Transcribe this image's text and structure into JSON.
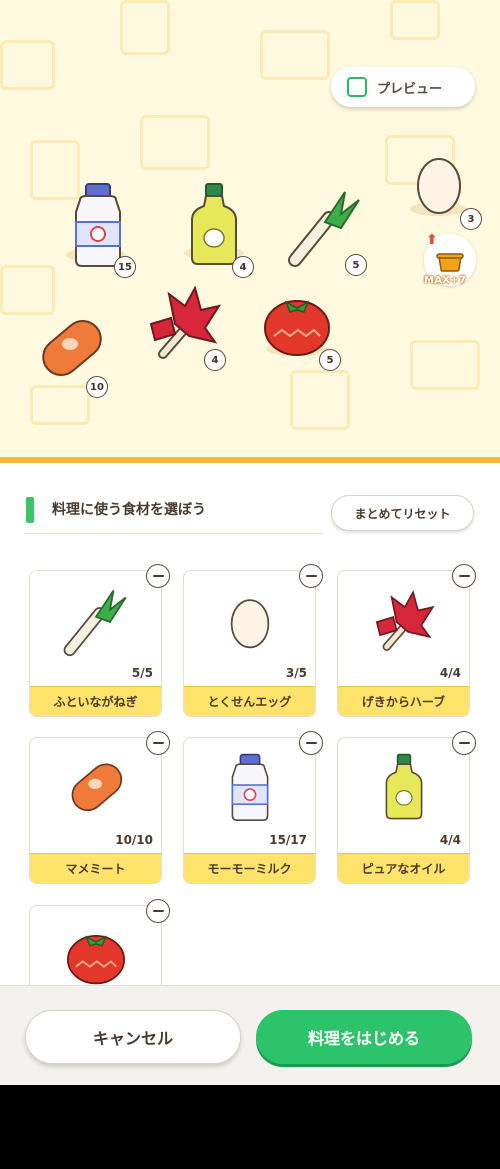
{
  "preview": {
    "label": "プレビュー",
    "checked": false
  },
  "stage_items": [
    {
      "name": "milk",
      "count": "15"
    },
    {
      "name": "oil",
      "count": "4"
    },
    {
      "name": "leek",
      "count": "5"
    },
    {
      "name": "egg",
      "count": "3"
    },
    {
      "name": "sausage",
      "count": "10"
    },
    {
      "name": "herb",
      "count": "4"
    },
    {
      "name": "tomato",
      "count": "5"
    }
  ],
  "pot": {
    "max_label": "MAX+7",
    "icon": "cooking-pot-icon"
  },
  "section": {
    "title": "料理に使う食材を選ぼう",
    "reset_label": "まとめてリセット"
  },
  "cards": [
    {
      "name": "ふといながねぎ",
      "qty": "5/5",
      "icon": "leek"
    },
    {
      "name": "とくせんエッグ",
      "qty": "3/5",
      "icon": "egg"
    },
    {
      "name": "げきからハーブ",
      "qty": "4/4",
      "icon": "herb"
    },
    {
      "name": "マメミート",
      "qty": "10/10",
      "icon": "sausage"
    },
    {
      "name": "モーモーミルク",
      "qty": "15/17",
      "icon": "milk"
    },
    {
      "name": "ピュアなオイル",
      "qty": "4/4",
      "icon": "oil"
    },
    {
      "name": "",
      "qty": "",
      "icon": "tomato"
    }
  ],
  "footer": {
    "cancel_label": "キャンセル",
    "start_label": "料理をはじめる"
  },
  "colors": {
    "accent_green": "#2cc36a",
    "card_label_yellow": "#ffe36b",
    "stage_bg": "#fff9e0"
  }
}
